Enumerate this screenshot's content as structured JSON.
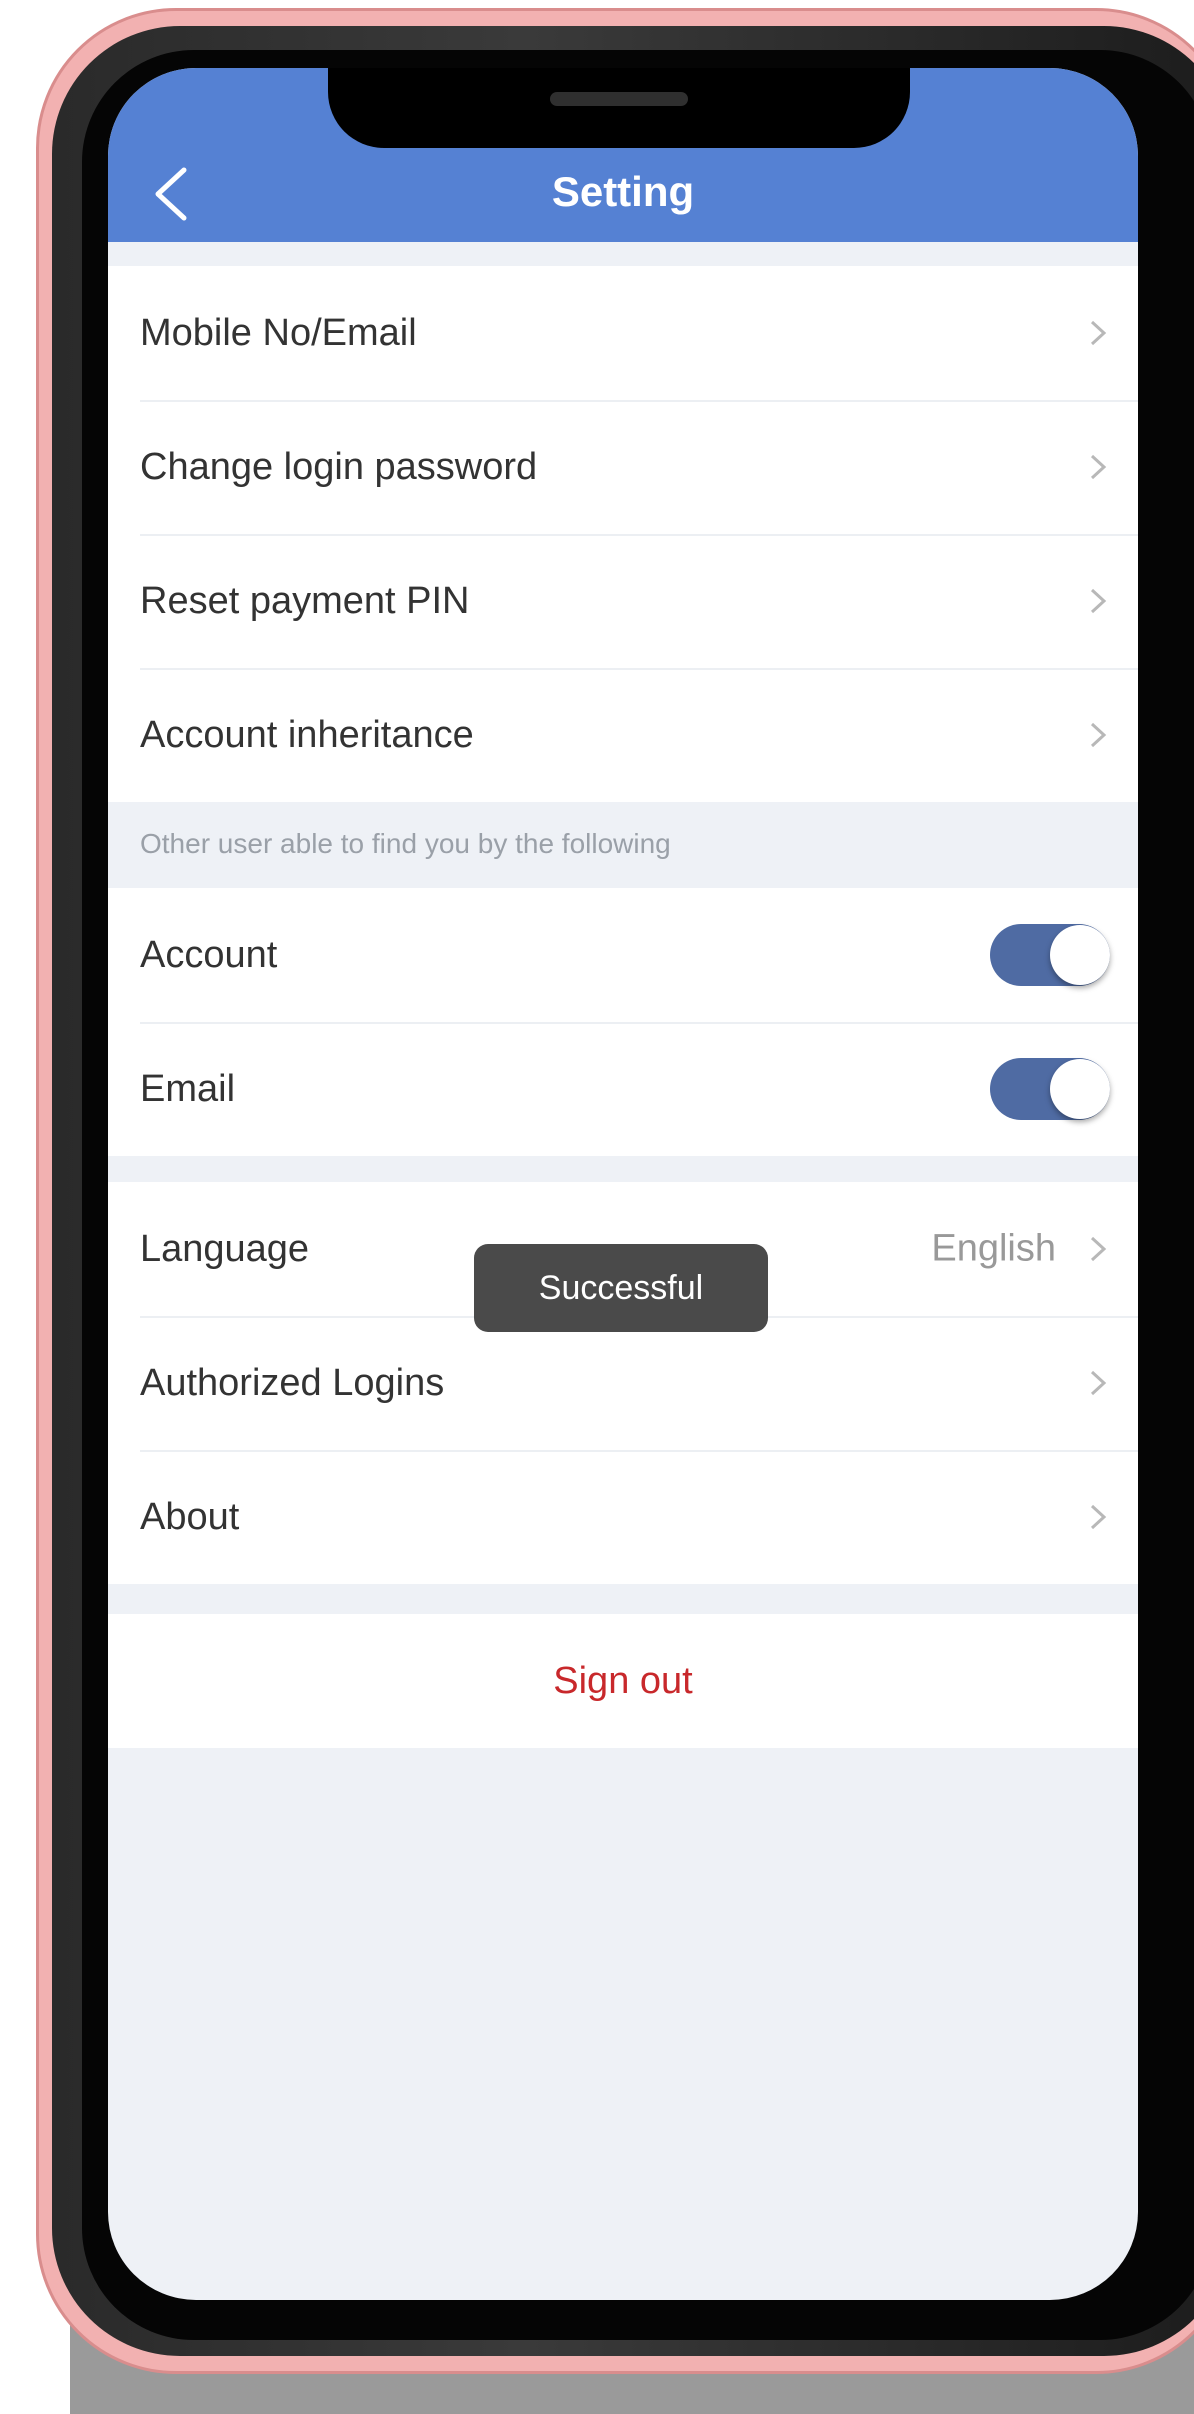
{
  "header": {
    "title": "Setting"
  },
  "account_group": [
    {
      "label": "Mobile No/Email"
    },
    {
      "label": "Change login password"
    },
    {
      "label": "Reset payment PIN"
    },
    {
      "label": "Account inheritance"
    }
  ],
  "find_section": {
    "caption": "Other user able to find you by the following",
    "items": [
      {
        "label": "Account",
        "enabled": true
      },
      {
        "label": "Email",
        "enabled": true
      }
    ]
  },
  "general_group": [
    {
      "label": "Language",
      "value": "English"
    },
    {
      "label": "Authorized Logins"
    },
    {
      "label": "About"
    }
  ],
  "signout": {
    "label": "Sign out"
  },
  "toast": {
    "message": "Successful"
  },
  "colors": {
    "header": "#5581d3",
    "toggle_on": "#4f6ba3",
    "signout": "#c8282b",
    "background": "#eef1f6"
  },
  "icons": {
    "back": "back-chevron-icon",
    "row_chevron": "chevron-right-icon"
  }
}
